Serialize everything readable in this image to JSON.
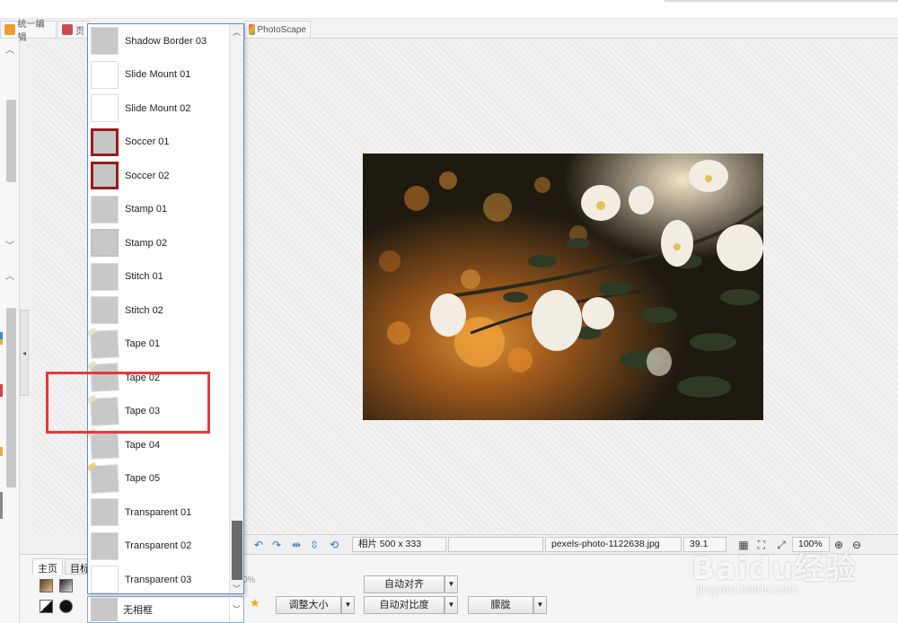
{
  "tabs": [
    {
      "label": "统一编辑"
    },
    {
      "label": "页"
    },
    {
      "label": "PhotoScape"
    }
  ],
  "frame_list": {
    "items": [
      {
        "label": "Shadow Border 03",
        "thumb": "plain"
      },
      {
        "label": "Slide Mount 01",
        "thumb": "white"
      },
      {
        "label": "Slide Mount 02",
        "thumb": "white"
      },
      {
        "label": "Soccer 01",
        "thumb": "red"
      },
      {
        "label": "Soccer 02",
        "thumb": "red"
      },
      {
        "label": "Stamp 01",
        "thumb": "plain"
      },
      {
        "label": "Stamp 02",
        "thumb": "stamp"
      },
      {
        "label": "Stitch 01",
        "thumb": "plain"
      },
      {
        "label": "Stitch 02",
        "thumb": "plain"
      },
      {
        "label": "Tape 01",
        "thumb": "tape"
      },
      {
        "label": "Tape 02",
        "thumb": "tape"
      },
      {
        "label": "Tape 03",
        "thumb": "tape"
      },
      {
        "label": "Tape 04",
        "thumb": "tape"
      },
      {
        "label": "Tape 05",
        "thumb": "tape5"
      },
      {
        "label": "Transparent 01",
        "thumb": "plain"
      },
      {
        "label": "Transparent 02",
        "thumb": "plain"
      },
      {
        "label": "Transparent 03",
        "thumb": "white"
      }
    ],
    "highlighted": "Tape 03"
  },
  "status": {
    "photo_size": "相片 500 x 333",
    "filename": "pexels-photo-1122638.jpg",
    "filesize": "39.1 KB",
    "zoom": "100%"
  },
  "bottom": {
    "tab_home": "主页",
    "tab_object": "目标",
    "frame_selected": "无相框",
    "percent_placeholder": "0%",
    "buttons": {
      "auto_align": "自动对齐",
      "resize": "调整大小",
      "auto_contrast": "自动对比度",
      "sharpen": "朦胧"
    }
  },
  "watermark": {
    "logo": "Baidu经验",
    "url": "jingyan.baidu.com"
  },
  "colors": {
    "highlight": "#e23b3b",
    "dropdown_border": "#5b8fc8",
    "soccer_red": "#9a1b1b"
  }
}
